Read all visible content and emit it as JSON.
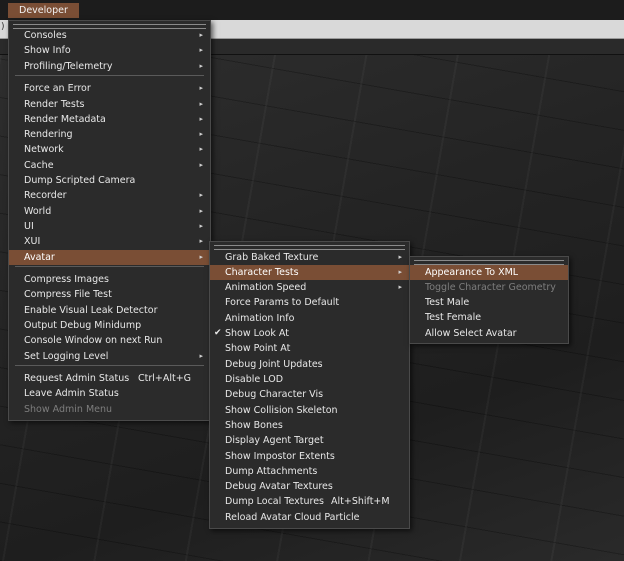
{
  "menubar": {
    "developer": "Developer"
  },
  "toolbar_fragment": ")",
  "developer_menu": {
    "items": [
      {
        "label": "Consoles",
        "arrow": "▸"
      },
      {
        "label": "Show Info",
        "arrow": "▸"
      },
      {
        "label": "Profiling/Telemetry",
        "arrow": "▸"
      },
      {
        "label": "Force an Error",
        "arrow": "▸"
      },
      {
        "label": "Render Tests",
        "arrow": "▸"
      },
      {
        "label": "Render Metadata",
        "arrow": "▸"
      },
      {
        "label": "Rendering",
        "arrow": "▸"
      },
      {
        "label": "Network",
        "arrow": "▸"
      },
      {
        "label": "Cache",
        "arrow": "▸"
      },
      {
        "label": "Dump Scripted Camera"
      },
      {
        "label": "Recorder",
        "arrow": "▸"
      },
      {
        "label": "World",
        "arrow": "▸"
      },
      {
        "label": "UI",
        "arrow": "▸"
      },
      {
        "label": "XUI",
        "arrow": "▸"
      },
      {
        "label": "Avatar",
        "arrow": "▸"
      },
      {
        "label": "Compress Images"
      },
      {
        "label": "Compress File Test"
      },
      {
        "label": "Enable Visual Leak Detector"
      },
      {
        "label": "Output Debug Minidump"
      },
      {
        "label": "Console Window on next Run"
      },
      {
        "label": "Set Logging Level",
        "arrow": "▸"
      },
      {
        "label": "Request Admin Status",
        "shortcut": "Ctrl+Alt+G"
      },
      {
        "label": "Leave Admin Status"
      },
      {
        "label": "Show Admin Menu"
      }
    ]
  },
  "avatar_menu": {
    "items": [
      {
        "label": "Grab Baked Texture",
        "arrow": "▸"
      },
      {
        "label": "Character Tests",
        "arrow": "▸"
      },
      {
        "label": "Animation Speed",
        "arrow": "▸"
      },
      {
        "label": "Force Params to Default"
      },
      {
        "label": "Animation Info"
      },
      {
        "label": "Show Look At",
        "check": "✔"
      },
      {
        "label": "Show Point At"
      },
      {
        "label": "Debug Joint Updates"
      },
      {
        "label": "Disable LOD"
      },
      {
        "label": "Debug Character Vis"
      },
      {
        "label": "Show Collision Skeleton"
      },
      {
        "label": "Show Bones"
      },
      {
        "label": "Display Agent Target"
      },
      {
        "label": "Show Impostor Extents"
      },
      {
        "label": "Dump Attachments"
      },
      {
        "label": "Debug Avatar Textures"
      },
      {
        "label": "Dump Local Textures",
        "shortcut": "Alt+Shift+M"
      },
      {
        "label": "Reload Avatar Cloud Particle"
      }
    ]
  },
  "character_tests_menu": {
    "items": [
      {
        "label": "Appearance To XML"
      },
      {
        "label": "Toggle Character Geometry"
      },
      {
        "label": "Test Male"
      },
      {
        "label": "Test Female"
      },
      {
        "label": "Allow Select Avatar"
      }
    ]
  },
  "colors": {
    "highlight": "#7a4e35",
    "menu_bg": "#2b2b2b",
    "disabled_text": "#7d7d7d",
    "toolbar": "#d9d9d9"
  }
}
